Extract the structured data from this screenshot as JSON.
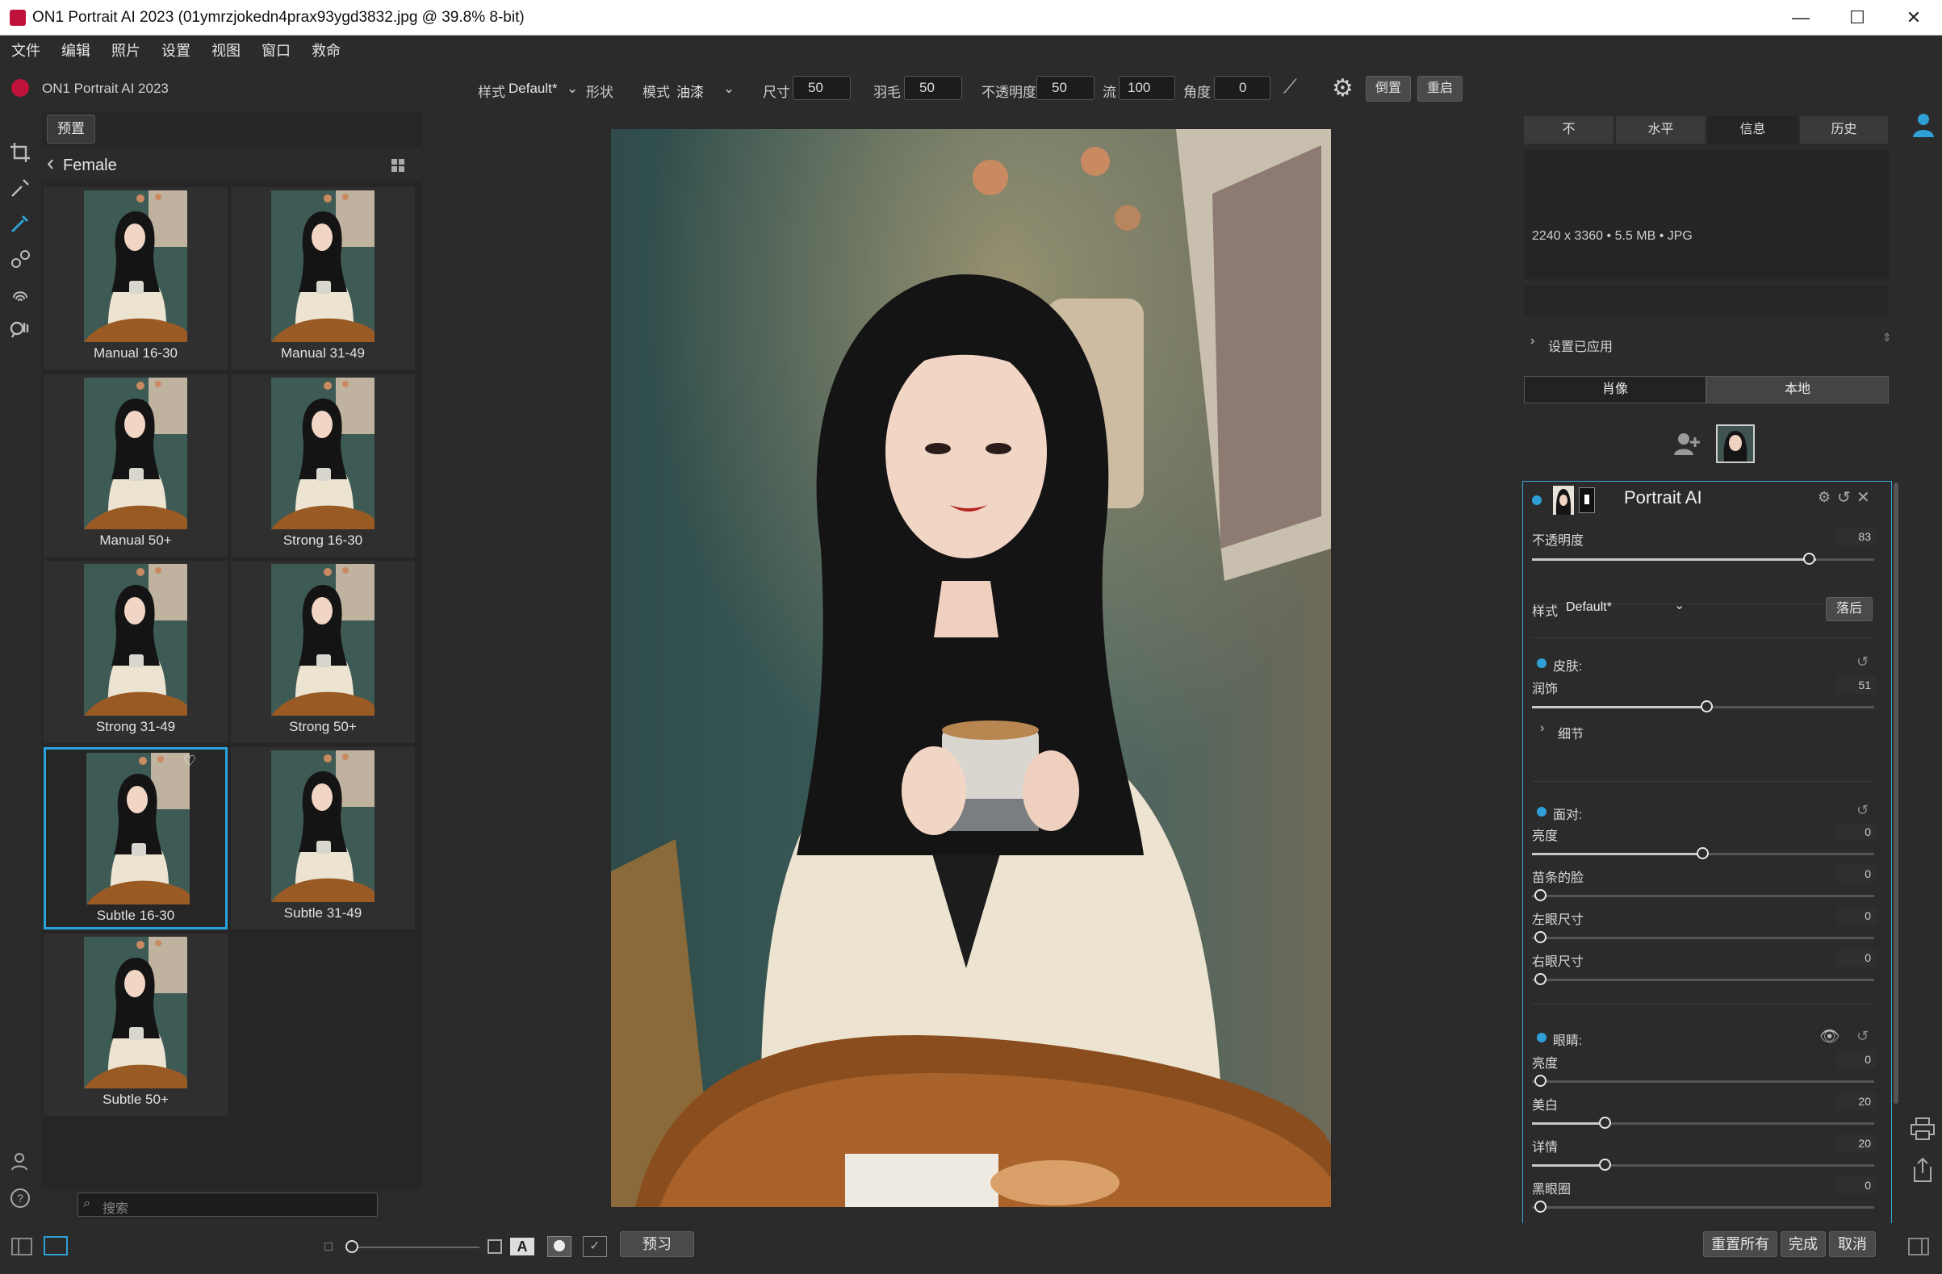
{
  "window": {
    "title": "ON1 Portrait AI 2023 (01ymrzjokedn4prax93ygd3832.jpg @ 39.8% 8-bit)",
    "minimize": "—",
    "maximize": "☐",
    "close": "✕"
  },
  "menu": [
    "文件",
    "编辑",
    "照片",
    "设置",
    "视图",
    "窗口",
    "救命"
  ],
  "toolbar": {
    "app_name": "ON1 Portrait AI 2023",
    "style_label": "样式",
    "style_value": "Default*",
    "shape_label": "形状",
    "mode_label": "模式",
    "mode_value": "油漆",
    "size_label": "尺寸",
    "size_value": "50",
    "feather_label": "羽毛",
    "feather_value": "50",
    "opacity_label": "不透明度",
    "opacity_value": "50",
    "flow_label": "流",
    "flow_value": "100",
    "angle_label": "角度",
    "angle_value": "0",
    "invert_button": "倒置",
    "restart_button": "重启"
  },
  "browse": {
    "preset_button": "预置",
    "folder": "Female",
    "search_placeholder": "搜索",
    "thumbs": [
      {
        "label": "Manual 16-30"
      },
      {
        "label": "Manual 31-49"
      },
      {
        "label": "Manual 50+"
      },
      {
        "label": "Strong 16-30"
      },
      {
        "label": "Strong 31-49"
      },
      {
        "label": "Strong 50+"
      },
      {
        "label": "Subtle 16-30"
      },
      {
        "label": "Subtle 31-49"
      },
      {
        "label": "Subtle 50+"
      }
    ]
  },
  "right": {
    "tabs": [
      "不",
      "水平",
      "信息",
      "历史"
    ],
    "active_tab": "信息",
    "info_text": "2240 x 3360 • 5.5 MB • JPG",
    "settings_applied": "设置已应用",
    "mode_tabs": [
      "肖像",
      "本地"
    ],
    "layer_title": "Portrait AI",
    "opacity_label": "不透明度",
    "opacity_value": "83",
    "style_label": "样式",
    "style_value": "Default*",
    "fall_button": "落后",
    "skin": {
      "title": "皮肤:",
      "smooth_label": "润饰",
      "smooth_value": "51",
      "detail_label": "细节"
    },
    "face": {
      "title": "面对:",
      "brightness_label": "亮度",
      "brightness_value": "0",
      "slim_label": "苗条的脸",
      "slim_value": "0",
      "left_eye_label": "左眼尺寸",
      "left_eye_value": "0",
      "right_eye_label": "右眼尺寸",
      "right_eye_value": "0"
    },
    "eyes": {
      "title": "眼睛:",
      "brightness_label": "亮度",
      "brightness_value": "0",
      "whiten_label": "美白",
      "whiten_value": "20",
      "detail_label": "详情",
      "detail_value": "20",
      "dark_circles_label": "黑眼圈",
      "dark_circles_value": "0"
    }
  },
  "bottom": {
    "preview_button": "预习",
    "reset_all": "重置所有",
    "done": "完成",
    "cancel": "取消"
  }
}
